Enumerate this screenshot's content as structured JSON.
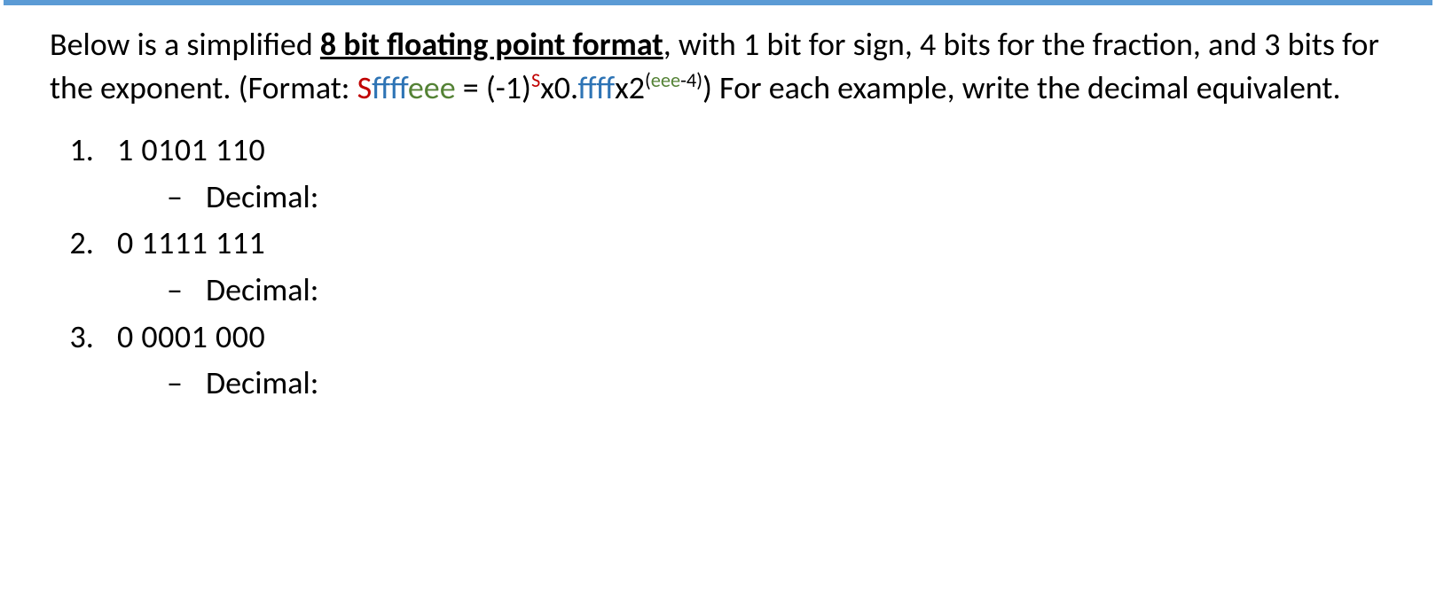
{
  "intro": {
    "prefix": "Below is a simplified ",
    "bold": "8 bit floating point format",
    "after_bold": ", with 1 bit for sign, 4 bits for the fraction, and 3 bits for the exponent. (Format: ",
    "fmt_S": "S",
    "fmt_f": "ffff",
    "fmt_e": "eee",
    "eq": " = (-1)",
    "sup_S": "S",
    "mid1": "x0.",
    "ffff2": "ffff",
    "mid2": "x2",
    "sup_open": "(",
    "sup_eee": "eee",
    "sup_minus4": "-4)",
    "tail": ") For each example, write the decimal equivalent."
  },
  "items": [
    {
      "bits": "1 0101 110",
      "label": "Decimal:"
    },
    {
      "bits": "0 1111 111",
      "label": "Decimal:"
    },
    {
      "bits": "0 0001 000",
      "label": "Decimal:"
    }
  ],
  "dash": "–"
}
